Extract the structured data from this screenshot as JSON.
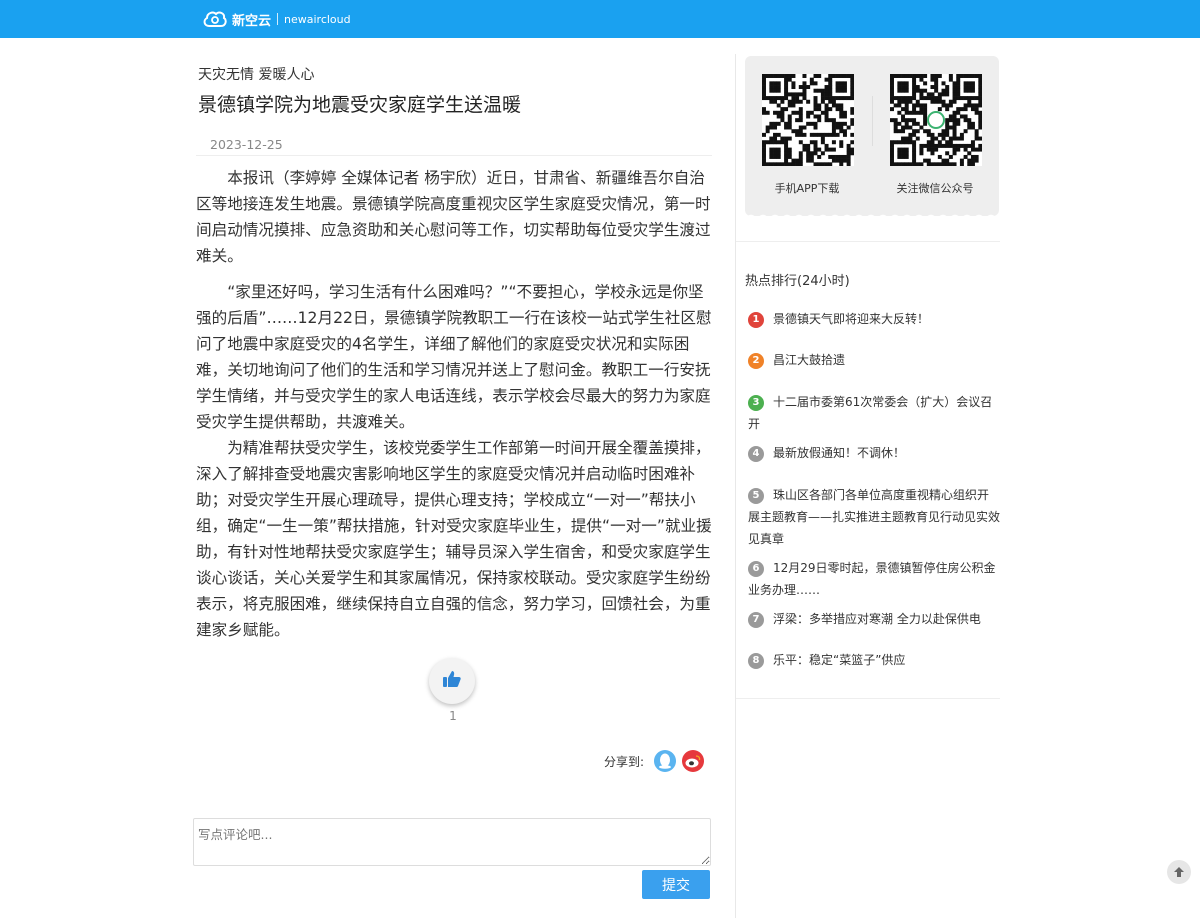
{
  "header": {
    "brand_cn": "新空云",
    "brand_en": "newaircloud"
  },
  "article": {
    "kicker": "天灾无情 爱暖人心",
    "title": "景德镇学院为地震受灾家庭学生送温暖",
    "date": "2023-12-25",
    "paragraphs": [
      "本报讯（李婷婷 全媒体记者 杨宇欣）近日，甘肃省、新疆维吾尔自治区等地接连发生地震。景德镇学院高度重视灾区学生家庭受灾情况，第一时间启动情况摸排、应急资助和关心慰问等工作，切实帮助每位受灾学生渡过难关。",
      "“家里还好吗，学习生活有什么困难吗？”“不要担心，学校永远是你坚强的后盾”……12月22日，景德镇学院教职工一行在该校一站式学生社区慰问了地震中家庭受灾的4名学生，详细了解他们的家庭受灾状况和实际困难，关切地询问了他们的生活和学习情况并送上了慰问金。教职工一行安抚学生情绪，并与受灾学生的家人电话连线，表示学校会尽最大的努力为家庭受灾学生提供帮助，共渡难关。",
      "为精准帮扶受灾学生，该校党委学生工作部第一时间开展全覆盖摸排，深入了解排查受地震灾害影响地区学生的家庭受灾情况并启动临时困难补助；对受灾学生开展心理疏导，提供心理支持；学校成立“一对一”帮扶小组，确定“一生一策”帮扶措施，针对受灾家庭毕业生，提供“一对一”就业援助，有针对性地帮扶受灾家庭学生；辅导员深入学生宿舍，和受灾家庭学生谈心谈话，关心关爱学生和其家属情况，保持家校联动。受灾家庭学生纷纷表示，将克服困难，继续保持自立自强的信念，努力学习，回馈社会，为重建家乡赋能。"
    ],
    "like_count": "1",
    "share_label": "分享到:"
  },
  "comment": {
    "placeholder": "写点评论吧...",
    "submit_label": "提交"
  },
  "sidebar": {
    "qr_app_label": "手机APP下载",
    "qr_wechat_label": "关注微信公众号",
    "hot_title": "热点排行(24小时)",
    "hot_items": [
      {
        "rank": "1",
        "text": "景德镇天气即将迎来大反转！",
        "color": "#e0443b"
      },
      {
        "rank": "2",
        "text": "昌江大鼓拾遗",
        "color": "#f08228"
      },
      {
        "rank": "3",
        "text": "十二届市委第61次常委会（扩大）会议召开",
        "color": "#4cb050"
      },
      {
        "rank": "4",
        "text": "最新放假通知！不调休！",
        "color": "#9a9a9a"
      },
      {
        "rank": "5",
        "text": "珠山区各部门各单位高度重视精心组织开展主题教育——扎实推进主题教育见行动见实效见真章",
        "color": "#9a9a9a"
      },
      {
        "rank": "6",
        "text": "12月29日零时起，景德镇暂停住房公积金业务办理……",
        "color": "#9a9a9a"
      },
      {
        "rank": "7",
        "text": "浮梁：多举措应对寒潮 全力以赴保供电",
        "color": "#9a9a9a"
      },
      {
        "rank": "8",
        "text": "乐平：稳定“菜篮子”供应",
        "color": "#9a9a9a"
      }
    ]
  }
}
